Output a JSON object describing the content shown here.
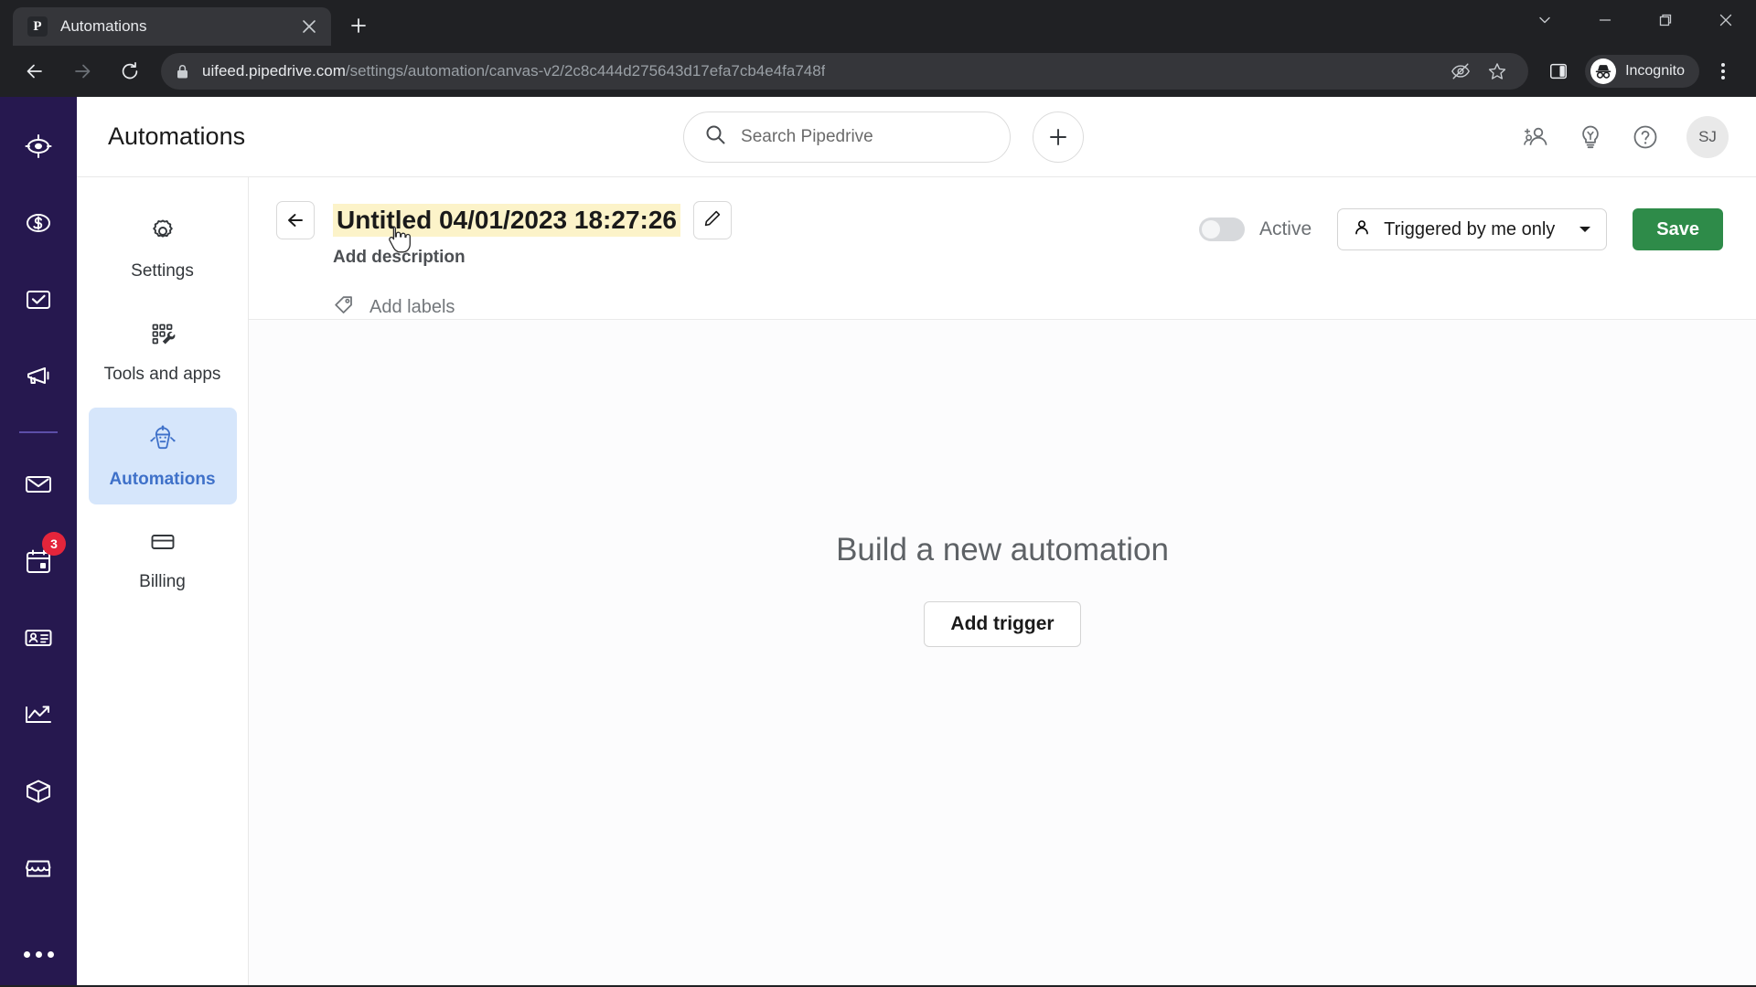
{
  "browser": {
    "tab": {
      "title": "Automations",
      "favicon_letter": "P",
      "close_icon": "close-icon"
    },
    "new_tab_icon": "plus-icon",
    "window_controls": [
      "tab-search-icon",
      "minimize-icon",
      "maximize-icon",
      "close-icon"
    ],
    "nav": {
      "back_icon": "back-arrow-icon",
      "forward_icon": "forward-arrow-icon",
      "reload_icon": "reload-icon"
    },
    "omnibox": {
      "lock_icon": "lock-icon",
      "host": "uifeed.pipedrive.com",
      "path": "/settings/automation/canvas-v2/2c8c444d275643d17efa7cb4e4fa748f",
      "tracking_icon": "eye-off-icon",
      "bookmark_icon": "star-icon"
    },
    "side_panel_icon": "side-panel-icon",
    "incognito": {
      "label": "Incognito",
      "icon": "incognito-icon"
    },
    "menu_icon": "three-dots-vertical-icon"
  },
  "rail": {
    "background": "#26184f",
    "items": [
      {
        "name": "leads",
        "icon": "target-icon"
      },
      {
        "name": "deals",
        "icon": "dollar-circle-icon"
      },
      {
        "name": "activities",
        "icon": "checkbox-icon"
      },
      {
        "name": "campaigns",
        "icon": "megaphone-icon"
      },
      {
        "name": "mail",
        "icon": "envelope-icon"
      },
      {
        "name": "calendar",
        "icon": "calendar-icon",
        "badge": "3"
      },
      {
        "name": "contacts",
        "icon": "contact-card-icon"
      },
      {
        "name": "insights",
        "icon": "trend-chart-icon"
      },
      {
        "name": "products",
        "icon": "box-icon"
      },
      {
        "name": "marketplace",
        "icon": "storefront-icon"
      }
    ],
    "more_icon": "three-dots-icon"
  },
  "header": {
    "title": "Automations",
    "search": {
      "placeholder": "Search Pipedrive",
      "icon": "search-icon"
    },
    "add_icon": "plus-icon",
    "actions": [
      {
        "name": "invite-users",
        "icon": "add-user-icon"
      },
      {
        "name": "whats-new",
        "icon": "lightbulb-icon"
      },
      {
        "name": "help",
        "icon": "question-mark-icon"
      }
    ],
    "avatar_initials": "SJ"
  },
  "settings_nav": {
    "items": [
      {
        "label": "Settings",
        "icon": "gear-icon",
        "active": false
      },
      {
        "label": "Tools and apps",
        "icon": "grid-wrench-icon",
        "active": false
      },
      {
        "label": "Automations",
        "icon": "robot-icon",
        "active": true
      },
      {
        "label": "Billing",
        "icon": "credit-card-icon",
        "active": false
      }
    ],
    "active_bg": "#d6e6fb",
    "active_color": "#3f71c9"
  },
  "automation_bar": {
    "back_icon": "back-arrow-icon",
    "title": "Untitled 04/01/2023 18:27:26",
    "title_highlight": "#fcf3c9",
    "edit_icon": "pencil-icon",
    "description_placeholder": "Add description",
    "labels_placeholder": "Add labels",
    "labels_icon": "tag-icon",
    "toggle": {
      "label": "Active",
      "state": "off"
    },
    "trigger_select": {
      "value": "Triggered by me only",
      "icon": "person-icon",
      "caret": "caret-down-icon"
    },
    "save_button": {
      "label": "Save",
      "color": "#2e8b49"
    }
  },
  "canvas": {
    "heading": "Build a new automation",
    "add_trigger_label": "Add trigger"
  }
}
